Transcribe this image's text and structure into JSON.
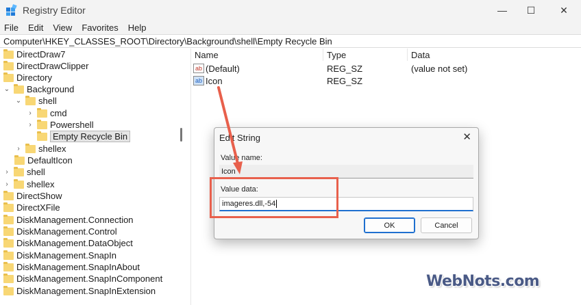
{
  "window": {
    "title": "Registry Editor",
    "minimize_glyph": "—",
    "maximize_glyph": "☐",
    "close_glyph": "✕"
  },
  "menu": [
    "File",
    "Edit",
    "View",
    "Favorites",
    "Help"
  ],
  "address": "Computer\\HKEY_CLASSES_ROOT\\Directory\\Background\\shell\\Empty Recycle Bin",
  "tree": [
    {
      "label": "DirectDraw7",
      "chevron": ""
    },
    {
      "label": "DirectDrawClipper",
      "chevron": ""
    },
    {
      "label": "Directory",
      "chevron": ""
    },
    {
      "label": "Background",
      "chevron": "⌄"
    },
    {
      "label": "shell",
      "chevron": "⌄"
    },
    {
      "label": "cmd",
      "chevron": "›"
    },
    {
      "label": "Powershell",
      "chevron": "›"
    },
    {
      "label": "Empty Recycle Bin",
      "chevron": ""
    },
    {
      "label": "shellex",
      "chevron": "›"
    },
    {
      "label": "DefaultIcon",
      "chevron": ""
    },
    {
      "label": "shell",
      "chevron": "›"
    },
    {
      "label": "shellex",
      "chevron": "›"
    },
    {
      "label": "DirectShow",
      "chevron": ""
    },
    {
      "label": "DirectXFile",
      "chevron": ""
    },
    {
      "label": "DiskManagement.Connection",
      "chevron": ""
    },
    {
      "label": "DiskManagement.Control",
      "chevron": ""
    },
    {
      "label": "DiskManagement.DataObject",
      "chevron": ""
    },
    {
      "label": "DiskManagement.SnapIn",
      "chevron": ""
    },
    {
      "label": "DiskManagement.SnapInAbout",
      "chevron": ""
    },
    {
      "label": "DiskManagement.SnapInComponent",
      "chevron": ""
    },
    {
      "label": "DiskManagement.SnapInExtension",
      "chevron": ""
    }
  ],
  "list": {
    "headers": {
      "name": "Name",
      "type": "Type",
      "data": "Data"
    },
    "rows": [
      {
        "icon_text": "ab",
        "name": "(Default)",
        "type": "REG_SZ",
        "data": "(value not set)"
      },
      {
        "icon_text": "ab",
        "name": "Icon",
        "type": "REG_SZ",
        "data": ""
      }
    ]
  },
  "dialog": {
    "title": "Edit String",
    "close_glyph": "✕",
    "value_name_label": "Value name:",
    "value_name": "Icon",
    "value_data_label": "Value data:",
    "value_data": "imageres.dll,-54",
    "ok_label": "OK",
    "cancel_label": "Cancel"
  },
  "watermark": "WebNots.com",
  "colors": {
    "annotation": "#e8604c",
    "accent": "#1e6fcf",
    "folder": "#f8d775"
  }
}
